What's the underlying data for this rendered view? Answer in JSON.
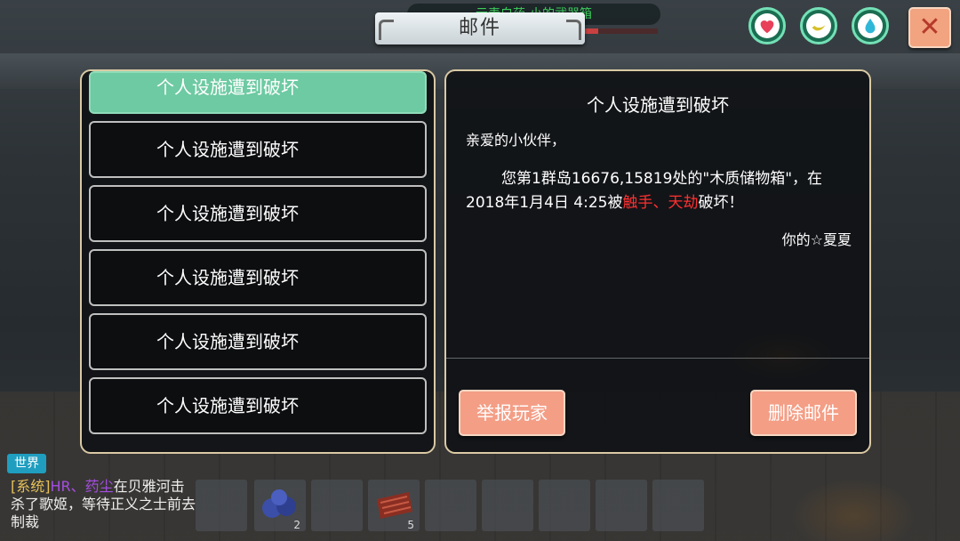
{
  "header": {
    "title": "邮件",
    "quest_text": "云麦白药-小的武器箱",
    "quest_progress": 0.75
  },
  "status_icons": [
    {
      "name": "health",
      "icon": "heart-icon",
      "color": "#e8405a"
    },
    {
      "name": "hunger",
      "icon": "banana-icon",
      "color": "#d6c02a"
    },
    {
      "name": "thirst",
      "icon": "water-drop-icon",
      "color": "#2fb7d8"
    }
  ],
  "close_label": "✕",
  "mail_list": [
    {
      "label": "个人设施遭到破坏",
      "selected": true
    },
    {
      "label": "个人设施遭到破坏",
      "selected": false
    },
    {
      "label": "个人设施遭到破坏",
      "selected": false
    },
    {
      "label": "个人设施遭到破坏",
      "selected": false
    },
    {
      "label": "个人设施遭到破坏",
      "selected": false
    },
    {
      "label": "个人设施遭到破坏",
      "selected": false
    }
  ],
  "mail": {
    "title": "个人设施遭到破坏",
    "greeting": "亲爱的小伙伴，",
    "body_before": "您第1群岛16676,15819处的\"木质储物箱\"，在2018年1月4日 4:25被",
    "attackers": "触手、天劫",
    "body_after": "破坏！",
    "signature": "你的☆夏夏"
  },
  "buttons": {
    "report": "举报玩家",
    "delete": "删除邮件"
  },
  "chat": {
    "channel": "世界",
    "system_tag": "[系统]",
    "player": "HR、药尘",
    "message": "在贝雅河击杀了歌姬，等待正义之士前去制裁"
  },
  "hotbar": [
    {
      "item": "",
      "count": ""
    },
    {
      "item": "blueberries",
      "count": "2"
    },
    {
      "item": "",
      "count": ""
    },
    {
      "item": "raw-meat",
      "count": "5"
    },
    {
      "item": "",
      "count": ""
    },
    {
      "item": "",
      "count": ""
    },
    {
      "item": "",
      "count": ""
    },
    {
      "item": "",
      "count": ""
    },
    {
      "item": "",
      "count": ""
    }
  ]
}
